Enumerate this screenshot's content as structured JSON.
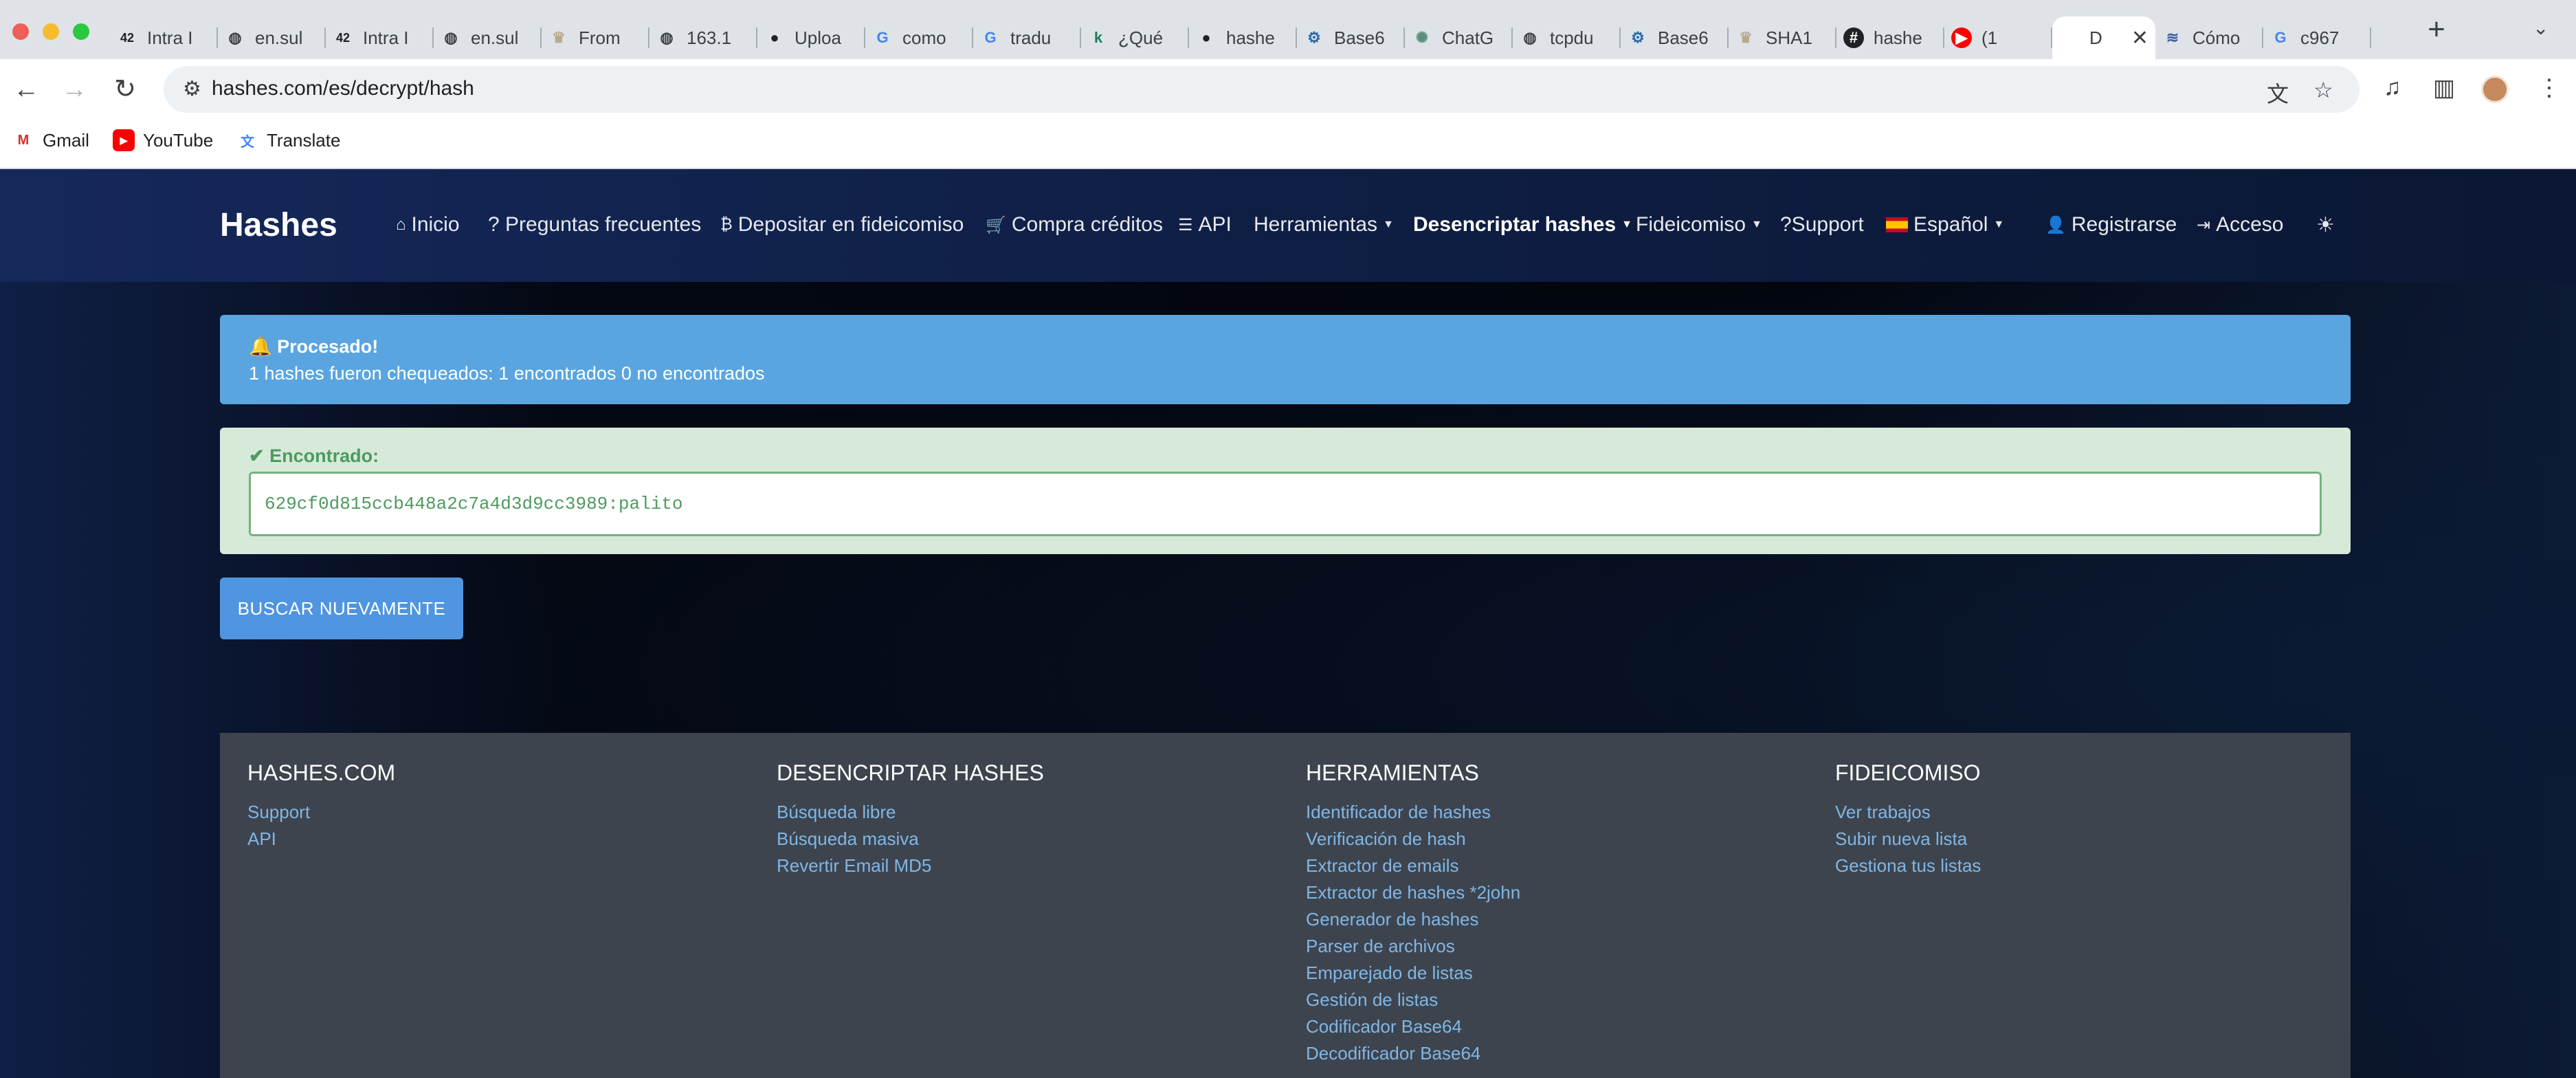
{
  "browser": {
    "tabs": [
      {
        "title": "Intra I",
        "icon": "42-logo-icon"
      },
      {
        "title": "en.sul",
        "icon": "globe-icon"
      },
      {
        "title": "Intra I",
        "icon": "42-logo-icon"
      },
      {
        "title": "en.sul",
        "icon": "globe-icon"
      },
      {
        "title": "From",
        "icon": "chef-hat-icon"
      },
      {
        "title": "163.1",
        "icon": "globe-icon"
      },
      {
        "title": "Uploa",
        "icon": "github-icon"
      },
      {
        "title": "como",
        "icon": "google-icon"
      },
      {
        "title": "tradu",
        "icon": "google-icon"
      },
      {
        "title": "¿Qué",
        "icon": "k-logo-icon"
      },
      {
        "title": "hashe",
        "icon": "github-icon"
      },
      {
        "title": "Base6",
        "icon": "gear-icon"
      },
      {
        "title": "ChatG",
        "icon": "chatgpt-icon"
      },
      {
        "title": "tcpdu",
        "icon": "globe-icon"
      },
      {
        "title": "Base6",
        "icon": "gear-icon"
      },
      {
        "title": "SHA1",
        "icon": "chef-hat-icon"
      },
      {
        "title": "hashe",
        "icon": "hashes-logo-icon"
      },
      {
        "title": "(1",
        "icon": "youtube-icon"
      },
      {
        "title": "D",
        "icon": "page-icon",
        "active": true
      },
      {
        "title": "Cómo",
        "icon": "site-icon"
      },
      {
        "title": "c967",
        "icon": "google-icon"
      }
    ],
    "url": "hashes.com/es/decrypt/hash",
    "bookmarks": [
      "Gmail",
      "YouTube",
      "Translate"
    ]
  },
  "site": {
    "brand": "Hashes",
    "nav": {
      "inicio": "Inicio",
      "faq": "? Preguntas frecuentes",
      "escrow_deposit": "Depositar en fideicomiso",
      "buy_credits": "Compra créditos",
      "api": "API",
      "tools": "Herramientas",
      "decrypt": "Desencriptar hashes",
      "escrow": "Fideicomiso",
      "support": "?Support",
      "language": "Español",
      "register": "Registrarse",
      "login": "Acceso"
    }
  },
  "processed": {
    "title": "Procesado!",
    "message": "1 hashes fueron chequeados: 1 encontrados 0 no encontrados"
  },
  "found": {
    "title": "Encontrado:",
    "result": "629cf0d815ccb448a2c7a4d3d9cc3989:palito"
  },
  "search_again_label": "BUSCAR NUEVAMENTE",
  "footer": {
    "columns": [
      {
        "heading": "HASHES.COM",
        "links": [
          "Support",
          "API"
        ]
      },
      {
        "heading": "DESENCRIPTAR HASHES",
        "links": [
          "Búsqueda libre",
          "Búsqueda masiva",
          "Revertir Email MD5"
        ]
      },
      {
        "heading": "HERRAMIENTAS",
        "links": [
          "Identificador de hashes",
          "Verificación de hash",
          "Extractor de emails",
          "Extractor de hashes *2john",
          "Generador de hashes",
          "Parser de archivos",
          "Emparejado de listas",
          "Gestión de listas",
          "Codificador Base64",
          "Decodificador Base64"
        ]
      },
      {
        "heading": "FIDEICOMISO",
        "links": [
          "Ver trabajos",
          "Subir nueva lista",
          "Gestiona tus listas"
        ]
      }
    ]
  },
  "colors": {
    "info_alert": "#5aa5e0",
    "success_bg": "#d7e9d9",
    "success_text": "#4d9b5d",
    "button": "#4f95df",
    "footer_bg": "#3e444e",
    "footer_link": "#7fb7e6"
  }
}
